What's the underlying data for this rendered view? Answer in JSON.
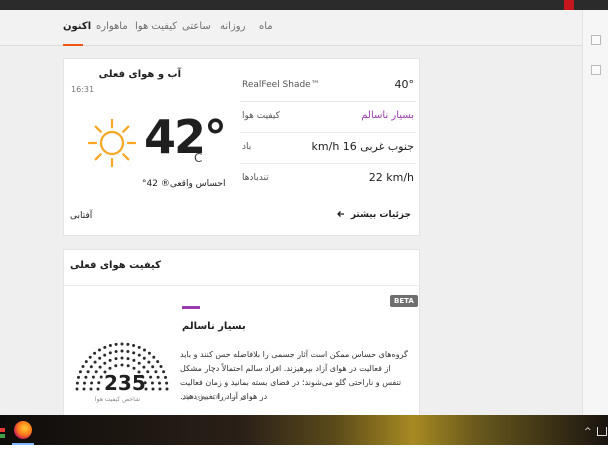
{
  "nav": {
    "tabs": [
      {
        "label": "اکنون",
        "active": true
      },
      {
        "label": "ماهواره",
        "active": false
      },
      {
        "label": "کیفیت هوا",
        "active": false
      },
      {
        "label": "ساعتی",
        "active": false
      },
      {
        "label": "روزانه",
        "active": false
      },
      {
        "label": "ماه",
        "active": false
      }
    ]
  },
  "current": {
    "title": "آب و هوای فعلی",
    "time": "16:31",
    "temperature": "42°",
    "unit": "C",
    "realfeel_line": "احساس واقعی® 42°",
    "phrase": "آفتابی",
    "more_link": "جزئیات بیشتر",
    "details": [
      {
        "label": "RealFeel Shade™",
        "value": "40°"
      },
      {
        "label": "کیفیت هوا",
        "value": "بسیار ناسالم"
      },
      {
        "label": "باد",
        "value": "جنوب غربی 16 km/h"
      },
      {
        "label": "تندبادها",
        "value": "22 km/h"
      }
    ]
  },
  "air_quality": {
    "title": "کیفیت هوای فعلی",
    "badge": "BETA",
    "category": "بسیار ناسالم",
    "description": "گروه‌های حساس ممکن است آثار جسمی را بلافاصله حس کنند و باید از فعالیت در هوای آزاد بپرهیزند. افراد سالم احتمالاً دچار مشکل تنفس و ناراحتی گلو می‌شوند؛ در فضای بسته بمانید و زمان فعالیت در هوای آزاد را تغییر دهید.",
    "basis": "بر اساس آلاینده‌های فعلی",
    "aqi": "235",
    "aqi_label": "شاخص کیفیت هوا"
  },
  "colors": {
    "accent": "#f05514",
    "purple": "#9b3cb0",
    "sun": "#f6a623"
  },
  "icons": {
    "weather": "sun-icon",
    "arrow": "arrow-left-icon",
    "browser": "firefox-icon"
  }
}
